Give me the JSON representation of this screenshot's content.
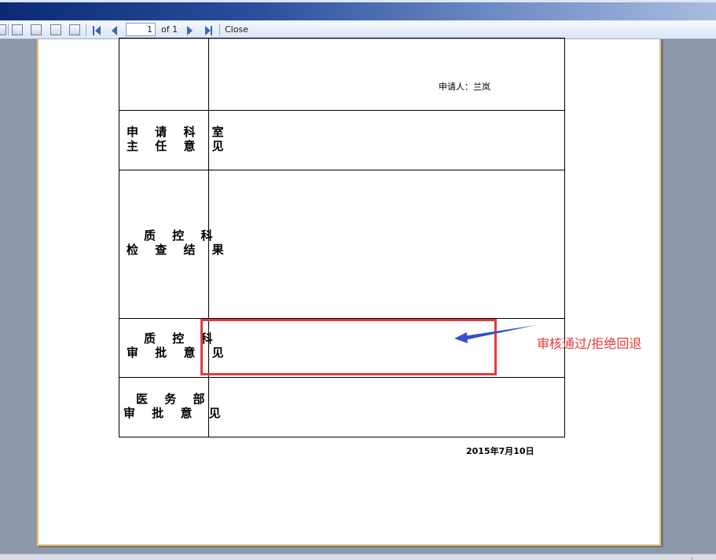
{
  "toolbar": {
    "page_number": "1",
    "page_of": "of 1",
    "close_label": "Close"
  },
  "form": {
    "applicant_line": "申请人：兰岚",
    "rows": [
      {
        "label_line1": "申 请 科 室",
        "label_line2": "主 任 意 见"
      },
      {
        "label_line1": "质 控 科",
        "label_line2": "检 查 结 果"
      },
      {
        "label_line1": "质 控 科",
        "label_line2": "审 批 意 见"
      },
      {
        "label_line1": "医 务 部",
        "label_line2": "审 批 意 见"
      }
    ],
    "date": "2015年7月10日"
  },
  "annotation": {
    "text": "审核通过/拒绝回退",
    "color": "#e53a3a"
  },
  "colors": {
    "arrow": "#3550c8",
    "page_border": "#e8c66c"
  }
}
